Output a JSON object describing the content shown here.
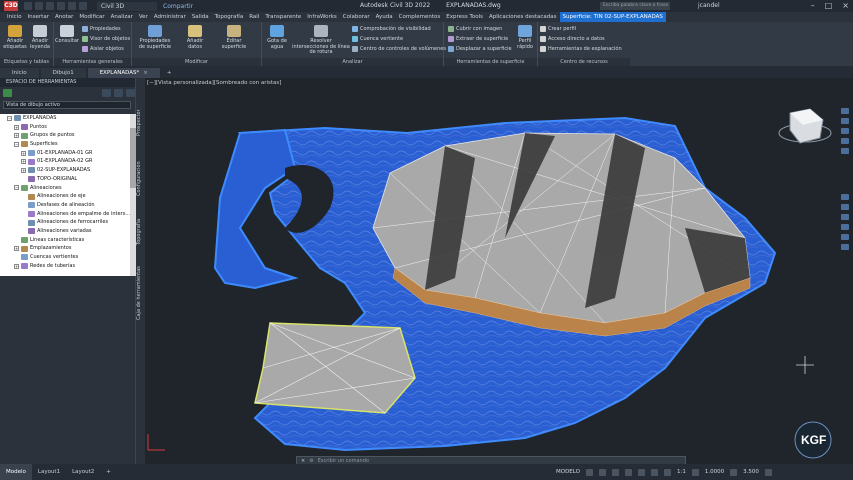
{
  "titlebar": {
    "logo": "C3D",
    "workspace": "Civil 3D",
    "share": "Compartir",
    "app_name": "Autodesk Civil 3D 2022",
    "file_name": "EXPLANADAS.dwg",
    "search_placeholder": "Escriba palabra clave o frase",
    "user": "jcandel"
  },
  "ribbon_tabs": [
    "Inicio",
    "Insertar",
    "Anotar",
    "Modificar",
    "Analizar",
    "Ver",
    "Administrar",
    "Salida",
    "Topografía",
    "Rail",
    "Transparente",
    "InfraWorks",
    "Colaborar",
    "Ayuda",
    "Complementos",
    "Express Tools",
    "Aplicaciones destacadas"
  ],
  "context_tab": "Superficie: TIN 02-SUP-EXPLANADAS",
  "ribbon": {
    "labels_group": {
      "btn1": "Añadir etiquetas",
      "btn2": "Añadir leyenda",
      "label": "Etiquetas y tablas"
    },
    "general_group": {
      "btn1": "Consultar",
      "small1": "Propiedades",
      "small2": "Visor de objetos",
      "small3": "Aislar objetos",
      "label": "Herramientas generales"
    },
    "modify_group": {
      "btn1": "Propiedades de superficie",
      "btn2": "Añadir datos",
      "btn3": "Editar superficie",
      "label": "Modificar"
    },
    "analyze_group": {
      "btn1": "Gota de agua",
      "btn2": "Resolver intersecciones de línea de rotura",
      "small1": "Comprobación de visibilidad",
      "small2": "Cuenca vertiente",
      "small3": "Centro de controles de volúmenes",
      "label": "Analizar"
    },
    "surface_tools_group": {
      "small1": "Cubrir con imagen",
      "small2": "Extraer de superficie",
      "small3": "Desplazar a superficie",
      "btn1": "Perfil rápido",
      "label": "Herramientas de superficie"
    },
    "resources_group": {
      "small1": "Crear perfil",
      "small2": "Acceso directo a datos",
      "small3": "Herramientas de explanación",
      "label": "Centro de recursos"
    }
  },
  "doc_tabs": [
    "Inicio",
    "Dibujo1",
    "EXPLANADAS*"
  ],
  "toolspace": {
    "title": "ESPACIO DE HERRAMIENTAS",
    "view_select": "Vista de dibujo activo",
    "tree": [
      {
        "label": "EXPLANADAS",
        "indent": 1,
        "exp": "−"
      },
      {
        "label": "Puntos",
        "indent": 2,
        "exp": "+"
      },
      {
        "label": "Grupos de puntos",
        "indent": 2,
        "exp": "+"
      },
      {
        "label": "Superficies",
        "indent": 2,
        "exp": "−"
      },
      {
        "label": "01-EXPLANADA-01 GR",
        "indent": 3,
        "exp": "+"
      },
      {
        "label": "01-EXPLANADA-02 GR",
        "indent": 3,
        "exp": "+"
      },
      {
        "label": "02-SUP-EXPLANADAS",
        "indent": 3,
        "exp": "+"
      },
      {
        "label": "TOPO-ORIGINAL",
        "indent": 3,
        "exp": ""
      },
      {
        "label": "Alineaciones",
        "indent": 2,
        "exp": "−"
      },
      {
        "label": "Alineaciones de eje",
        "indent": 3,
        "exp": ""
      },
      {
        "label": "Desfases de alineación",
        "indent": 3,
        "exp": ""
      },
      {
        "label": "Alineaciones de empalme de inters...",
        "indent": 3,
        "exp": ""
      },
      {
        "label": "Alineaciones de ferrocarriles",
        "indent": 3,
        "exp": ""
      },
      {
        "label": "Alineaciones variadas",
        "indent": 3,
        "exp": ""
      },
      {
        "label": "Líneas características",
        "indent": 2,
        "exp": ""
      },
      {
        "label": "Emplazamientos",
        "indent": 2,
        "exp": "+"
      },
      {
        "label": "Cuencas vertientes",
        "indent": 2,
        "exp": ""
      },
      {
        "label": "Redes de tuberías",
        "indent": 2,
        "exp": "+"
      }
    ],
    "side_tabs": [
      "Prospector",
      "Configuración",
      "Topografía",
      "Caja de herramientas"
    ]
  },
  "viewport": {
    "label": "[−][Vista personalizada][Sombreado con aristas]",
    "cmd_placeholder": "Escribir un comando"
  },
  "status": {
    "tabs": [
      "Modelo",
      "Layout1",
      "Layout2"
    ],
    "model": "MODELO",
    "scale": "1:1",
    "scale2": "1.0000",
    "value": "3.500"
  }
}
